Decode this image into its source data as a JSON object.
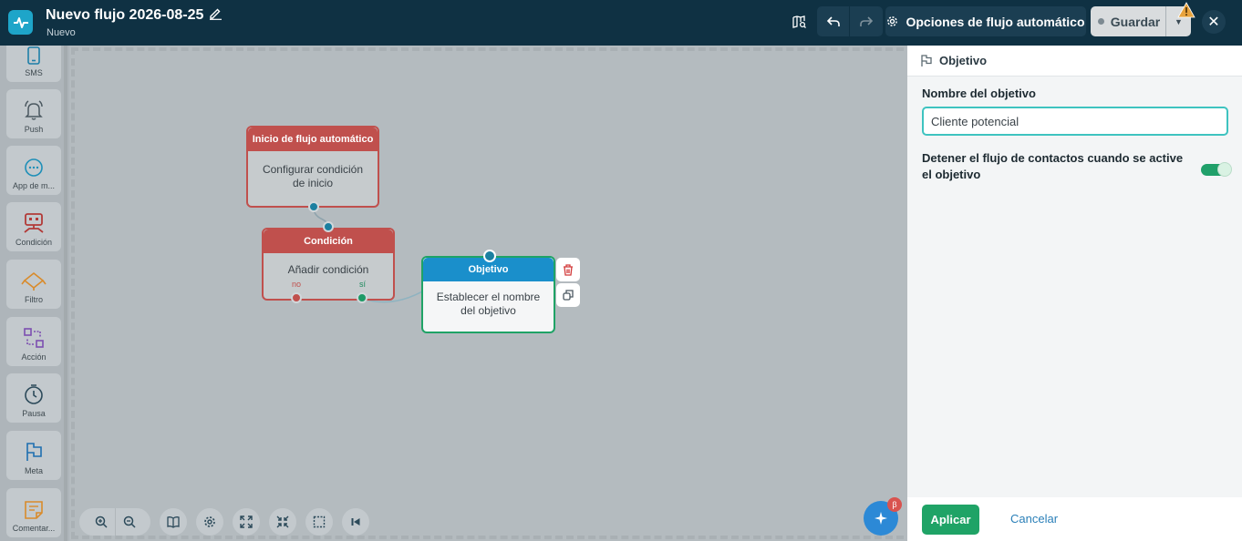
{
  "header": {
    "title": "Nuevo flujo 2026-08-25",
    "status": "Nuevo",
    "options_label": "Opciones de flujo automático",
    "save_label": "Guardar"
  },
  "palette": {
    "items": [
      {
        "label": "SMS",
        "icon": "sms-icon"
      },
      {
        "label": "Push",
        "icon": "bell-icon"
      },
      {
        "label": "App de m...",
        "icon": "chat-bubble-icon"
      },
      {
        "label": "Condición",
        "icon": "condition-icon"
      },
      {
        "label": "Filtro",
        "icon": "filter-icon"
      },
      {
        "label": "Acción",
        "icon": "action-icon"
      },
      {
        "label": "Pausa",
        "icon": "clock-icon"
      },
      {
        "label": "Meta",
        "icon": "flag-icon"
      },
      {
        "label": "Comentar...",
        "icon": "comment-icon"
      }
    ]
  },
  "canvas": {
    "start_node": {
      "title": "Inicio de flujo automático",
      "body": "Configurar condición de inicio"
    },
    "condition_node": {
      "title": "Condición",
      "body": "Añadir condición",
      "no_label": "no",
      "yes_label": "sí"
    },
    "goal_node": {
      "title": "Objetivo",
      "body": "Establecer el nombre del objetivo"
    },
    "ai_badge": "β"
  },
  "panel": {
    "title": "Objetivo",
    "name_label": "Nombre del objetivo",
    "name_value": "Cliente potencial",
    "toggle_label": "Detener el flujo de contactos cuando se active el objetivo",
    "toggle_on": true,
    "apply_label": "Aplicar",
    "cancel_label": "Cancelar"
  },
  "colors": {
    "topbar": "#0f3143",
    "accent_teal": "#1ea5c9",
    "node_red": "#c0504d",
    "goal_blue": "#1a8fcb",
    "apply_green": "#1fa366"
  }
}
